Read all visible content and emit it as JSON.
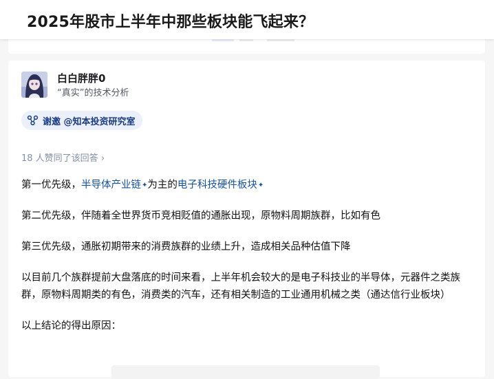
{
  "question": {
    "title": "2025年股市上半年中那些板块能飞起来？"
  },
  "author": {
    "name": "白白胖胖0",
    "bio": "“真实”的技术分析",
    "avatar_icon": "anime-girl-avatar"
  },
  "invite": {
    "label": "谢邀 @知本投资研究室",
    "icon": "invite-people-icon"
  },
  "votes": {
    "text": "18 人赞同了该回答",
    "chevron": "›"
  },
  "content": {
    "p1_prefix": "第一优先级，",
    "p1_link1": "半导体产业链",
    "p1_mid": "为主的",
    "p1_link2": "电子科技硬件板块",
    "p2": "第二优先级，伴随着全世界货币竞相贬值的通胀出现，原物料周期族群，比如有色",
    "p3": "第三优先级，通胀初期带来的消费族群的业绩上升，造成相关品种估值下降",
    "p4": "以目前几个族群提前大盘落底的时间来看，上半年机会较大的是电子科技业的半导体，元器件之类族群，原物料周期类的有色，消费类的汽车，还有相关制造的工业通用机械之类（通达信行业板块）",
    "p5": "以上结论的得出原因："
  },
  "colors": {
    "link": "#175199",
    "pill_bg": "#ebf0fa",
    "pill_text": "#1b3d80",
    "muted": "#8590a6"
  }
}
